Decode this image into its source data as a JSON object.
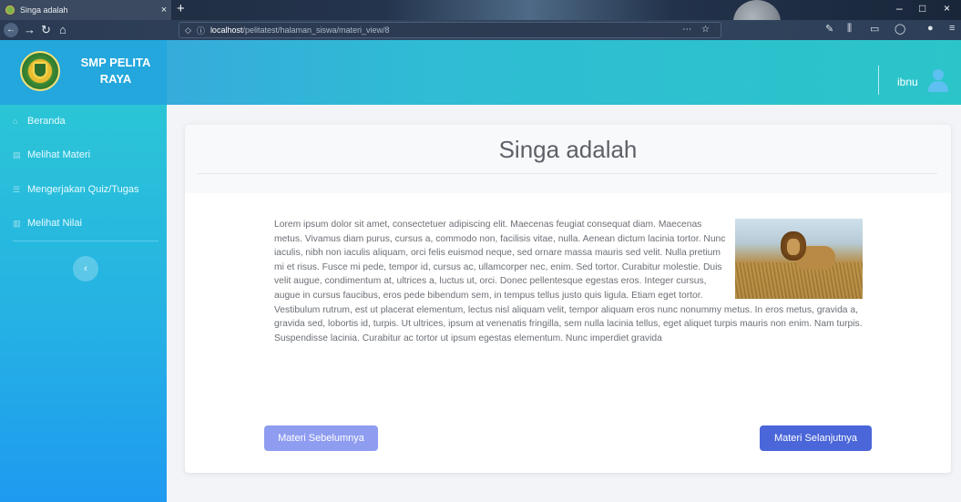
{
  "browser": {
    "tab_title": "Singa adalah",
    "tab_close": "×",
    "new_tab": "+",
    "url_host": "localhost",
    "url_path": "/pelitatest/halaman_siswa/materi_view/8",
    "url_actions": "⋯ ☆",
    "window_controls": [
      "–",
      "□",
      "×"
    ]
  },
  "header": {
    "school_name": "SMP PELITA RAYA",
    "user_name": "ibnu"
  },
  "sidebar": {
    "items": [
      {
        "label": "Beranda",
        "icon": "home-icon"
      },
      {
        "label": "Melihat Materi",
        "icon": "document-icon"
      },
      {
        "label": "Mengerjakan Quiz/Tugas",
        "icon": "list-icon"
      },
      {
        "label": "Melihat Nilai",
        "icon": "grade-icon"
      }
    ],
    "collapse_icon": "‹"
  },
  "main": {
    "title": "Singa adalah",
    "body": "Lorem ipsum dolor sit amet, consectetuer adipiscing elit. Maecenas feugiat consequat diam. Maecenas metus. Vivamus diam purus, cursus a, commodo non, facilisis vitae, nulla. Aenean dictum lacinia tortor. Nunc iaculis, nibh non iaculis aliquam, orci felis euismod neque, sed ornare massa mauris sed velit. Nulla pretium mi et risus. Fusce mi pede, tempor id, cursus ac, ullamcorper nec, enim. Sed tortor. Curabitur molestie. Duis velit augue, condimentum at, ultrices a, luctus ut, orci. Donec pellentesque egestas eros. Integer cursus, augue in cursus faucibus, eros pede bibendum sem, in tempus tellus justo quis ligula. Etiam eget tortor. Vestibulum rutrum, est ut placerat elementum, lectus nisl aliquam velit, tempor aliquam eros nunc nonummy metus. In eros metus, gravida a, gravida sed, lobortis id, turpis. Ut ultrices, ipsum at venenatis fringilla, sem nulla lacinia tellus, eget aliquet turpis mauris non enim. Nam turpis. Suspendisse lacinia. Curabitur ac tortor ut ipsum egestas elementum. Nunc imperdiet gravida",
    "prev_button": "Materi Sebelumnya",
    "next_button": "Materi Selanjutnya"
  },
  "colors": {
    "header_start": "#3aa1e0",
    "header_end": "#2bc5c9",
    "sidebar_top": "#2bc5d6",
    "sidebar_bottom": "#1f9af0",
    "next_button": "#4a66d9",
    "prev_button": "#8e9df0"
  }
}
